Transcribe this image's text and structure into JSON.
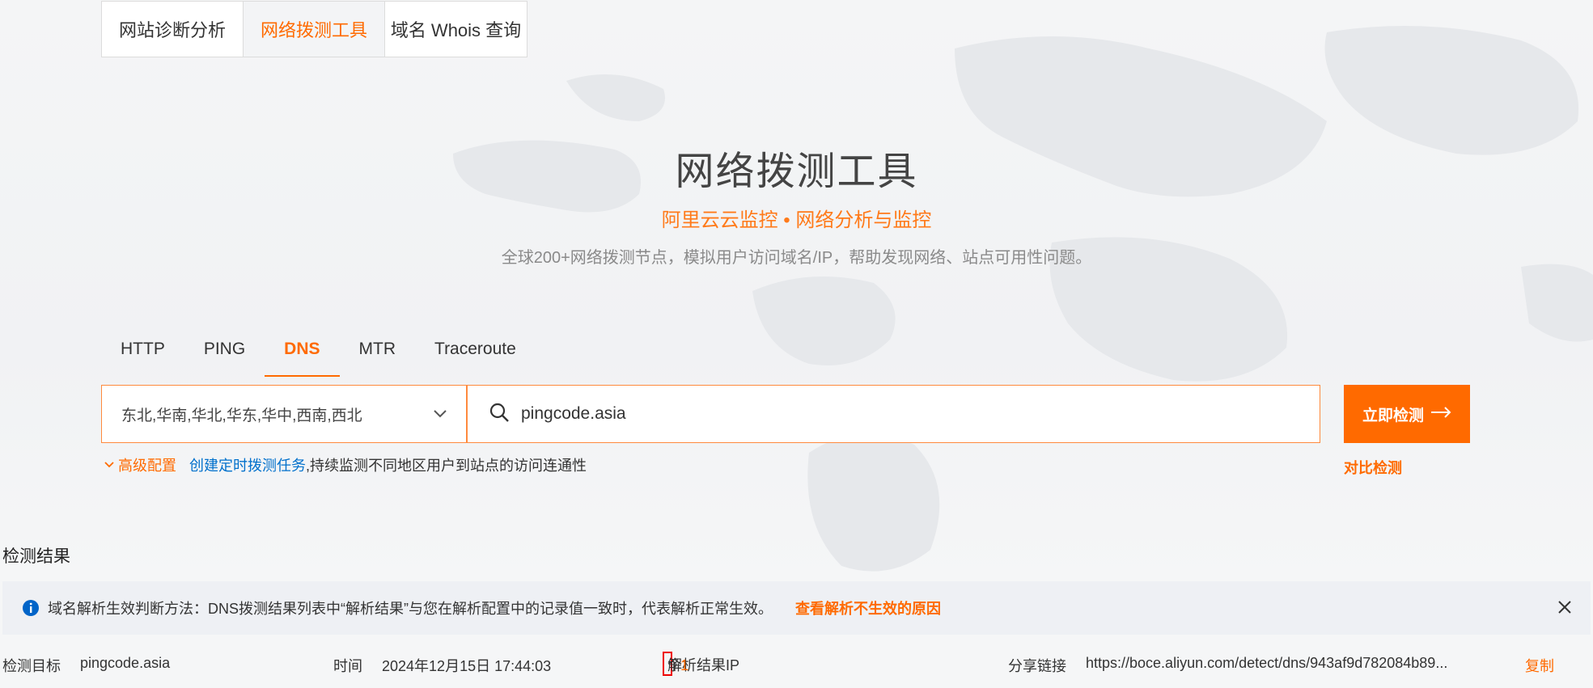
{
  "top_tabs": [
    "网站诊断分析",
    "网络拨测工具",
    "域名 Whois 查询"
  ],
  "active_top_tab": 1,
  "hero": {
    "title": "网络拨测工具",
    "subtitle": "阿里云云监控 • 网络分析与监控",
    "description": "全球200+网络拨测节点，模拟用户访问域名/IP，帮助发现网络、站点可用性问题。"
  },
  "protocol_tabs": [
    "HTTP",
    "PING",
    "DNS",
    "MTR",
    "Traceroute"
  ],
  "active_protocol": "DNS",
  "region_select": {
    "value": "东北,华南,华北,华东,华中,西南,西北"
  },
  "search": {
    "value": "pingcode.asia"
  },
  "detect_button": "立即检测",
  "compare_link": "对比检测",
  "advanced": {
    "toggle_label": "高级配置",
    "create_task_link": "创建定时拨测任务",
    "note": ",持续监测不同地区用户到站点的访问连通性"
  },
  "results_title": "检测结果",
  "info_bar": {
    "text": "域名解析生效判断方法：DNS拨测结果列表中“解析结果”与您在解析配置中的记录值一致时，代表解析正常生效。",
    "link": "查看解析不生效的原因"
  },
  "meta": {
    "target_label": "检测目标",
    "target_value": "pingcode.asia",
    "time_label": "时间",
    "time_value": "2024年12月15日 17:44:03",
    "ip_label": "解析结果IP",
    "ip_count": "1",
    "ip_unit": "个",
    "share_label": "分享链接",
    "share_url": "https://boce.aliyun.com/detect/dns/943af9d782084b89...",
    "copy_label": "复制"
  },
  "colors": {
    "accent": "#ff6a00",
    "link": "#0070cc",
    "highlight_box": "#e00000"
  }
}
